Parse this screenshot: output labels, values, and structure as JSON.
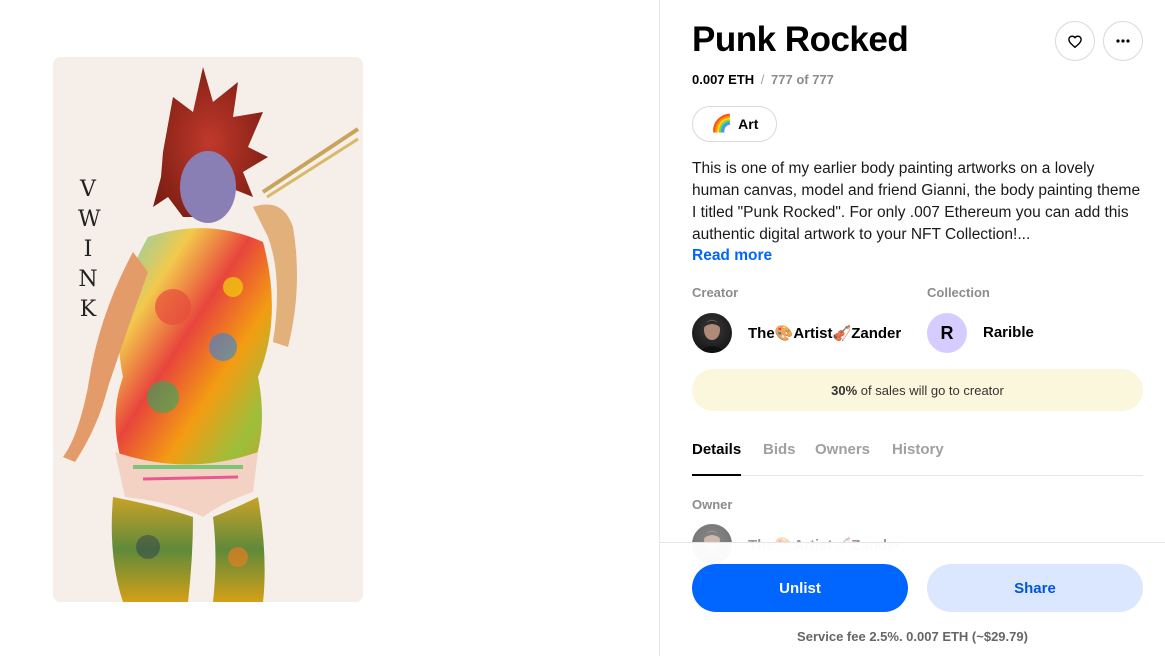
{
  "item": {
    "title": "Punk Rocked",
    "price": "0.007 ETH",
    "price_separator": "/",
    "supply": "777 of 777",
    "tag": {
      "emoji": "🌈",
      "label": "Art"
    },
    "description": "This is one of my earlier body painting artworks on a lovely human canvas, model and friend Gianni, the body painting theme I titled \"Punk Rocked\". For only .007 Ethereum you can add this authentic digital artwork to your NFT Collection!...",
    "read_more": "Read more"
  },
  "creator": {
    "label": "Creator",
    "name": "The🎨Artist🎻Zander"
  },
  "collection": {
    "label": "Collection",
    "name": "Rarible",
    "avatar_letter": "R"
  },
  "royalty": {
    "percent": "30%",
    "text": "of sales will go to creator"
  },
  "tabs": [
    {
      "label": "Details"
    },
    {
      "label": "Bids"
    },
    {
      "label": "Owners"
    },
    {
      "label": "History"
    }
  ],
  "owner": {
    "label": "Owner",
    "name": "The🎨Artist🎻Zander"
  },
  "actions": {
    "unlist_label": "Unlist",
    "share_label": "Share",
    "fee_text": "Service fee 2.5%. 0.007 ETH (~$29.79)"
  },
  "artwork": {
    "watermark": "VWINK"
  },
  "icons": {
    "like": "heart-icon",
    "more": "more-horizontal-icon"
  },
  "colors": {
    "accent": "#0066ff",
    "share_bg": "#dbe7ff",
    "royalty_bg": "#fbf7dc",
    "collection_avatar_bg": "#d6ccff"
  }
}
